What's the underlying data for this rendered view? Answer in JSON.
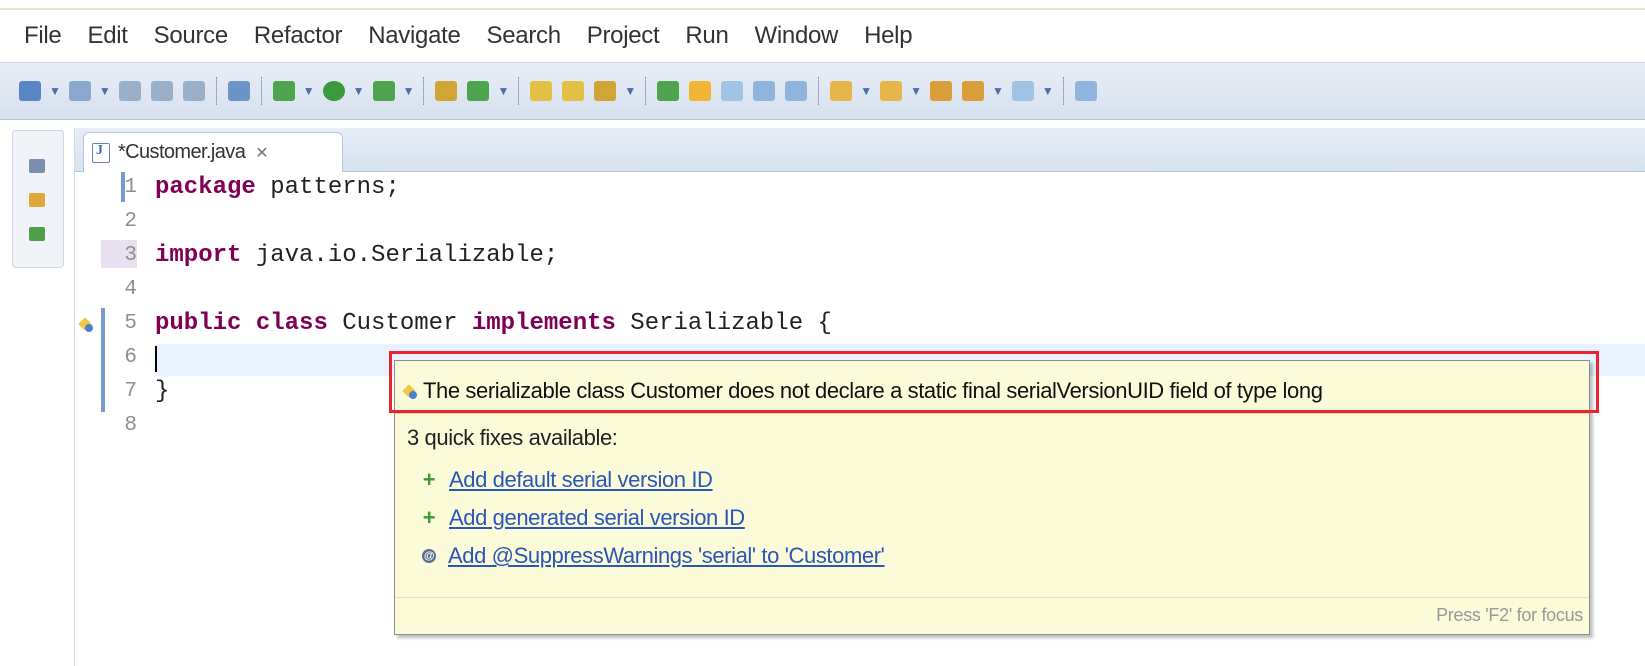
{
  "menu": [
    "File",
    "Edit",
    "Source",
    "Refactor",
    "Navigate",
    "Search",
    "Project",
    "Run",
    "Window",
    "Help"
  ],
  "editor": {
    "tab_label": "*Customer.java",
    "tab_close": "✕",
    "line_numbers": [
      "1",
      "2",
      "3",
      "4",
      "5",
      "6",
      "7",
      "8"
    ],
    "code": {
      "line1": {
        "keyword": "package",
        "rest": " patterns;"
      },
      "line3": {
        "keyword": "import",
        "rest": " java.io.Serializable;"
      },
      "line5": {
        "kw1": "public",
        "kw2": "class",
        "name": " Customer ",
        "kw3": "implements",
        "rest": " Serializable {"
      },
      "line7": "}"
    }
  },
  "quickfix": {
    "message": "The serializable class Customer does not declare a static final serialVersionUID field of type long",
    "count_text": "3 quick fixes available:",
    "fixes": [
      {
        "icon": "plus-icon",
        "label": "Add default serial version ID"
      },
      {
        "icon": "plus-icon",
        "label": "Add generated serial version ID"
      },
      {
        "icon": "annotation-icon",
        "label": "Add @SuppressWarnings 'serial' to 'Customer'"
      }
    ],
    "footer": "Press 'F2' for focus"
  },
  "colors": {
    "keyword": "#7f0055",
    "link": "#2a56b8",
    "hover_bg": "#fcfbd9",
    "highlight_border": "#e8252e",
    "current_line": "#e8f2fe"
  }
}
